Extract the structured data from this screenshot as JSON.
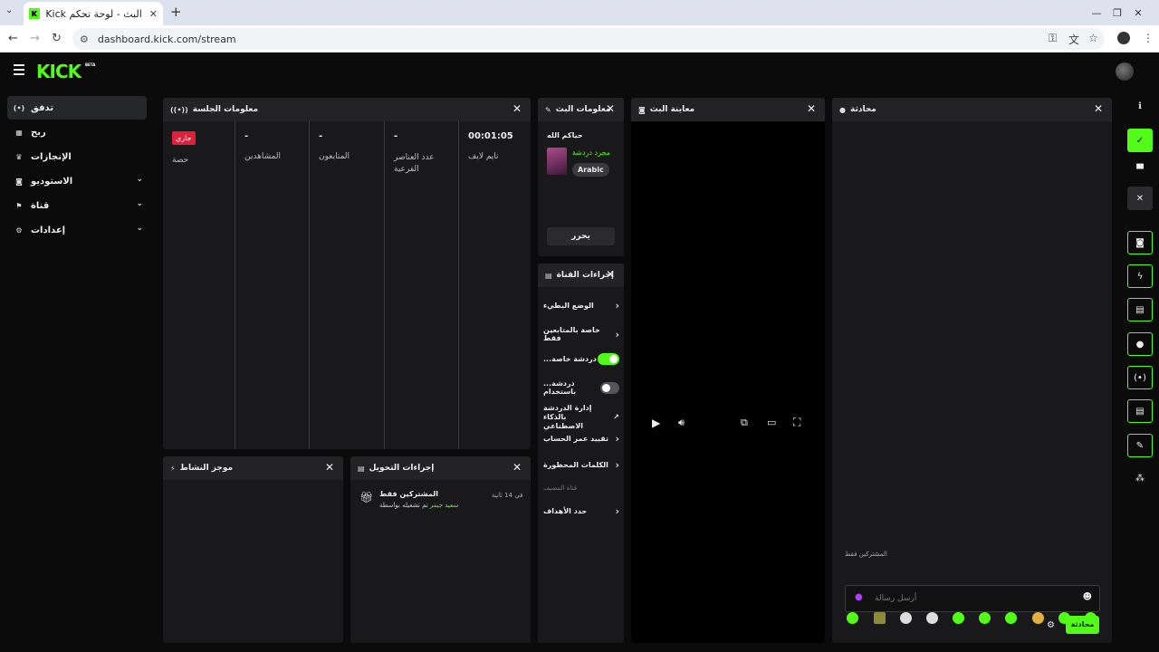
{
  "browser": {
    "tab_title": "البث - لوحة تحكم Kick",
    "url": "dashboard.kick.com/stream",
    "new_tab": "+",
    "tab_close": "✕"
  },
  "app": {
    "logo": "KICK",
    "beta": "BETA"
  },
  "sidebar": {
    "items": [
      {
        "label": "تدفق",
        "icon": "broadcast-icon",
        "active": true
      },
      {
        "label": "ربح",
        "icon": "chart-icon"
      },
      {
        "label": "الإنجازات",
        "icon": "trophy-icon"
      },
      {
        "label": "الاستوديو",
        "icon": "studio-icon",
        "expandable": true
      },
      {
        "label": "قناة",
        "icon": "channel-icon",
        "expandable": true
      },
      {
        "label": "إعدادات",
        "icon": "gear-icon",
        "expandable": true
      }
    ]
  },
  "session_panel": {
    "title": "معلومات الجلسة",
    "columns": [
      {
        "value": "00:01:05",
        "label": "تايم لايف"
      },
      {
        "value": "-",
        "label": "عدد العناصر الفرعية"
      },
      {
        "value": "-",
        "label": "المتابعون"
      },
      {
        "value": "-",
        "label": "المشاهدين"
      },
      {
        "badge": "جاري",
        "label": "حصة"
      }
    ]
  },
  "stream_info_panel": {
    "title": "معلومات البث",
    "stream_title": "حياكم الله",
    "category": "مجرد دردشة",
    "tag": "Arabic",
    "edit_button": "يحرر"
  },
  "preview_panel": {
    "title": "معاينة البث"
  },
  "chat_panel": {
    "title": "محادثة",
    "subscribers_only": "المشتركين فقط",
    "input_placeholder": "أرسل رسالة",
    "send_button": "محادثة"
  },
  "channel_actions_panel": {
    "title": "إجراءات القناة",
    "rows": [
      {
        "label": "الوضع البطيء",
        "type": "arrow"
      },
      {
        "label": "خاصة بالمتابعين فقط",
        "type": "arrow"
      },
      {
        "label": "...دردشة خاصة",
        "type": "toggle",
        "on": true
      },
      {
        "label": "...دردشة باستخدام",
        "type": "toggle",
        "on": false
      },
      {
        "label": "إدارة الدردشة بالذكاء الاصطناعي",
        "type": "external"
      },
      {
        "label": "تقييد عمر الحساب",
        "type": "arrow"
      },
      {
        "label": "الكلمات المحظورة",
        "type": "arrow"
      },
      {
        "label": "قناة المضيف",
        "type": "disabled"
      },
      {
        "label": "حدد الأهداف",
        "type": "arrow"
      }
    ]
  },
  "activity_panel": {
    "title": "موجز النشاط"
  },
  "moderation_panel": {
    "title": "إجراءات التحويل",
    "item_title": "المشتركين فقط",
    "item_user": "سعيد جيمر",
    "item_text": "تم تشغيله بواسطة",
    "item_time": "في 14 ثانية"
  },
  "colors": {
    "accent": "#53fc18",
    "live_badge": "#e0203a"
  }
}
